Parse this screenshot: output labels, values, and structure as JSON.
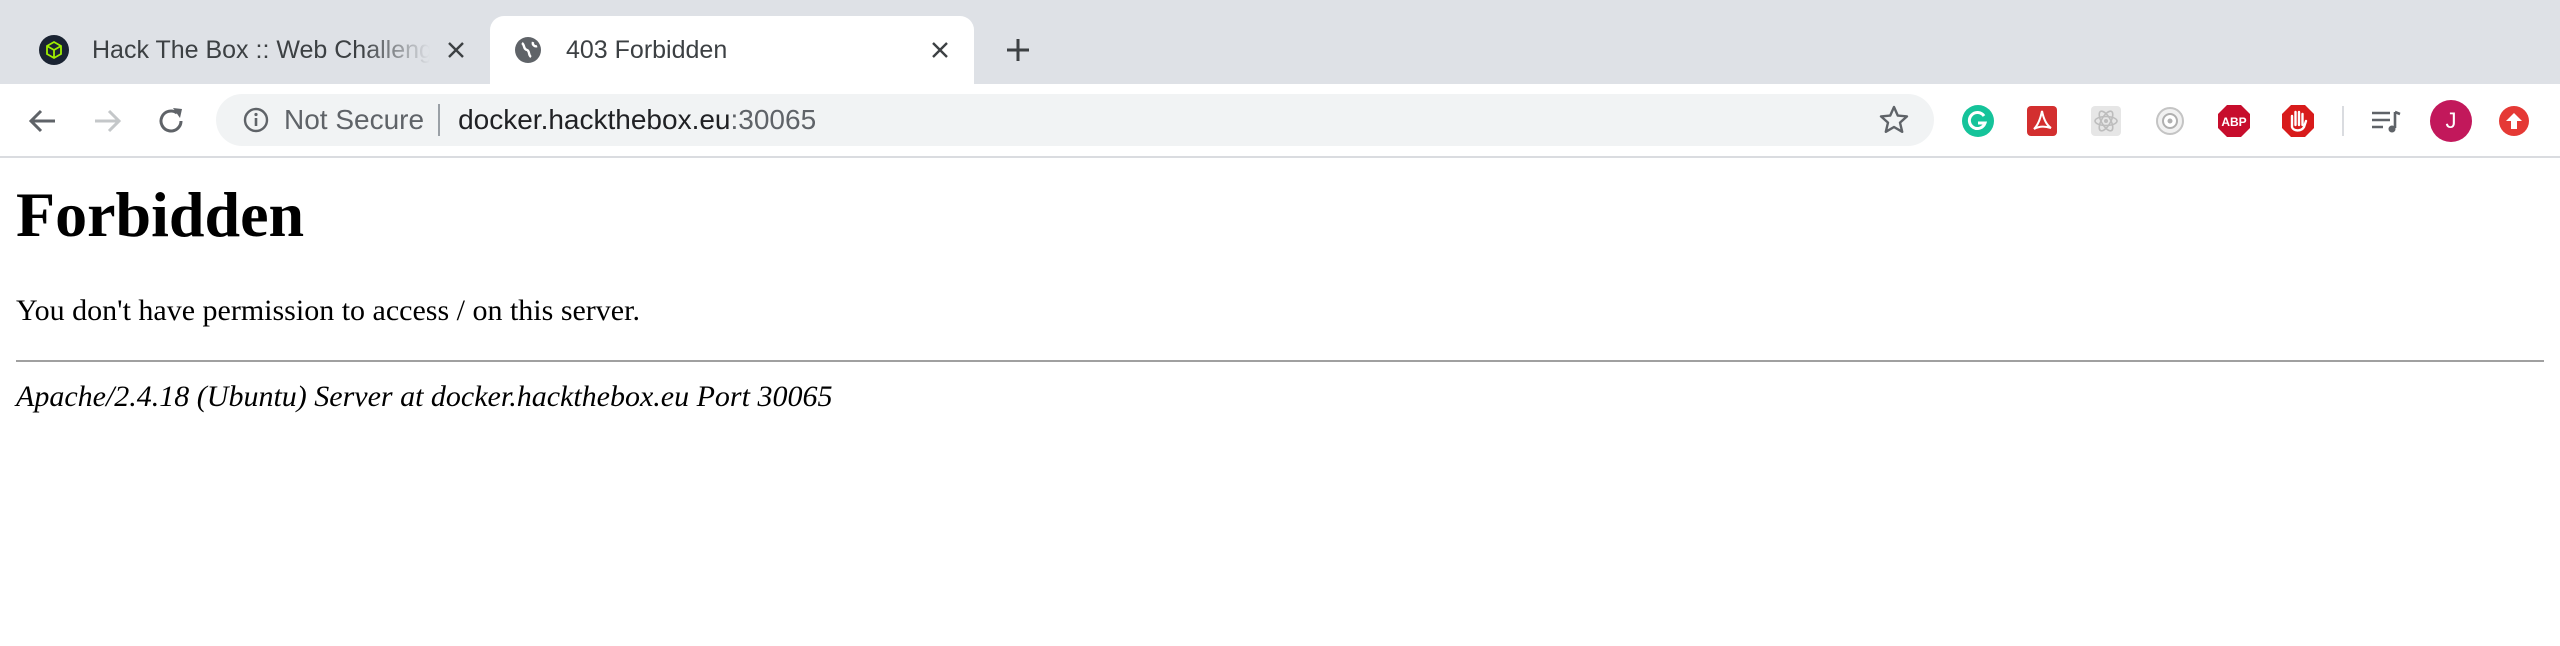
{
  "tabs": [
    {
      "title": "Hack The Box :: Web Challenges",
      "favicon": "hackthebox-cube-icon"
    },
    {
      "title": "403 Forbidden",
      "favicon": "globe-icon"
    }
  ],
  "omnibox": {
    "security_label": "Not Secure",
    "url_host": "docker.hackthebox.eu",
    "url_port": ":30065"
  },
  "extensions": [
    "grammarly-icon",
    "acrobat-icon",
    "react-devtools-icon",
    "webcam-icon",
    "adblock-plus-icon",
    "stop-hand-icon",
    "media-controls-icon"
  ],
  "profile": {
    "initial": "J",
    "color": "#c2185b"
  },
  "page": {
    "heading": "Forbidden",
    "message": "You don't have permission to access / on this server.",
    "server_signature": "Apache/2.4.18 (Ubuntu) Server at docker.hackthebox.eu Port 30065"
  },
  "colors": {
    "tabstrip": "#dee1e6",
    "omnibox": "#f1f3f4",
    "text": "#202124",
    "muted": "#5f6368"
  }
}
